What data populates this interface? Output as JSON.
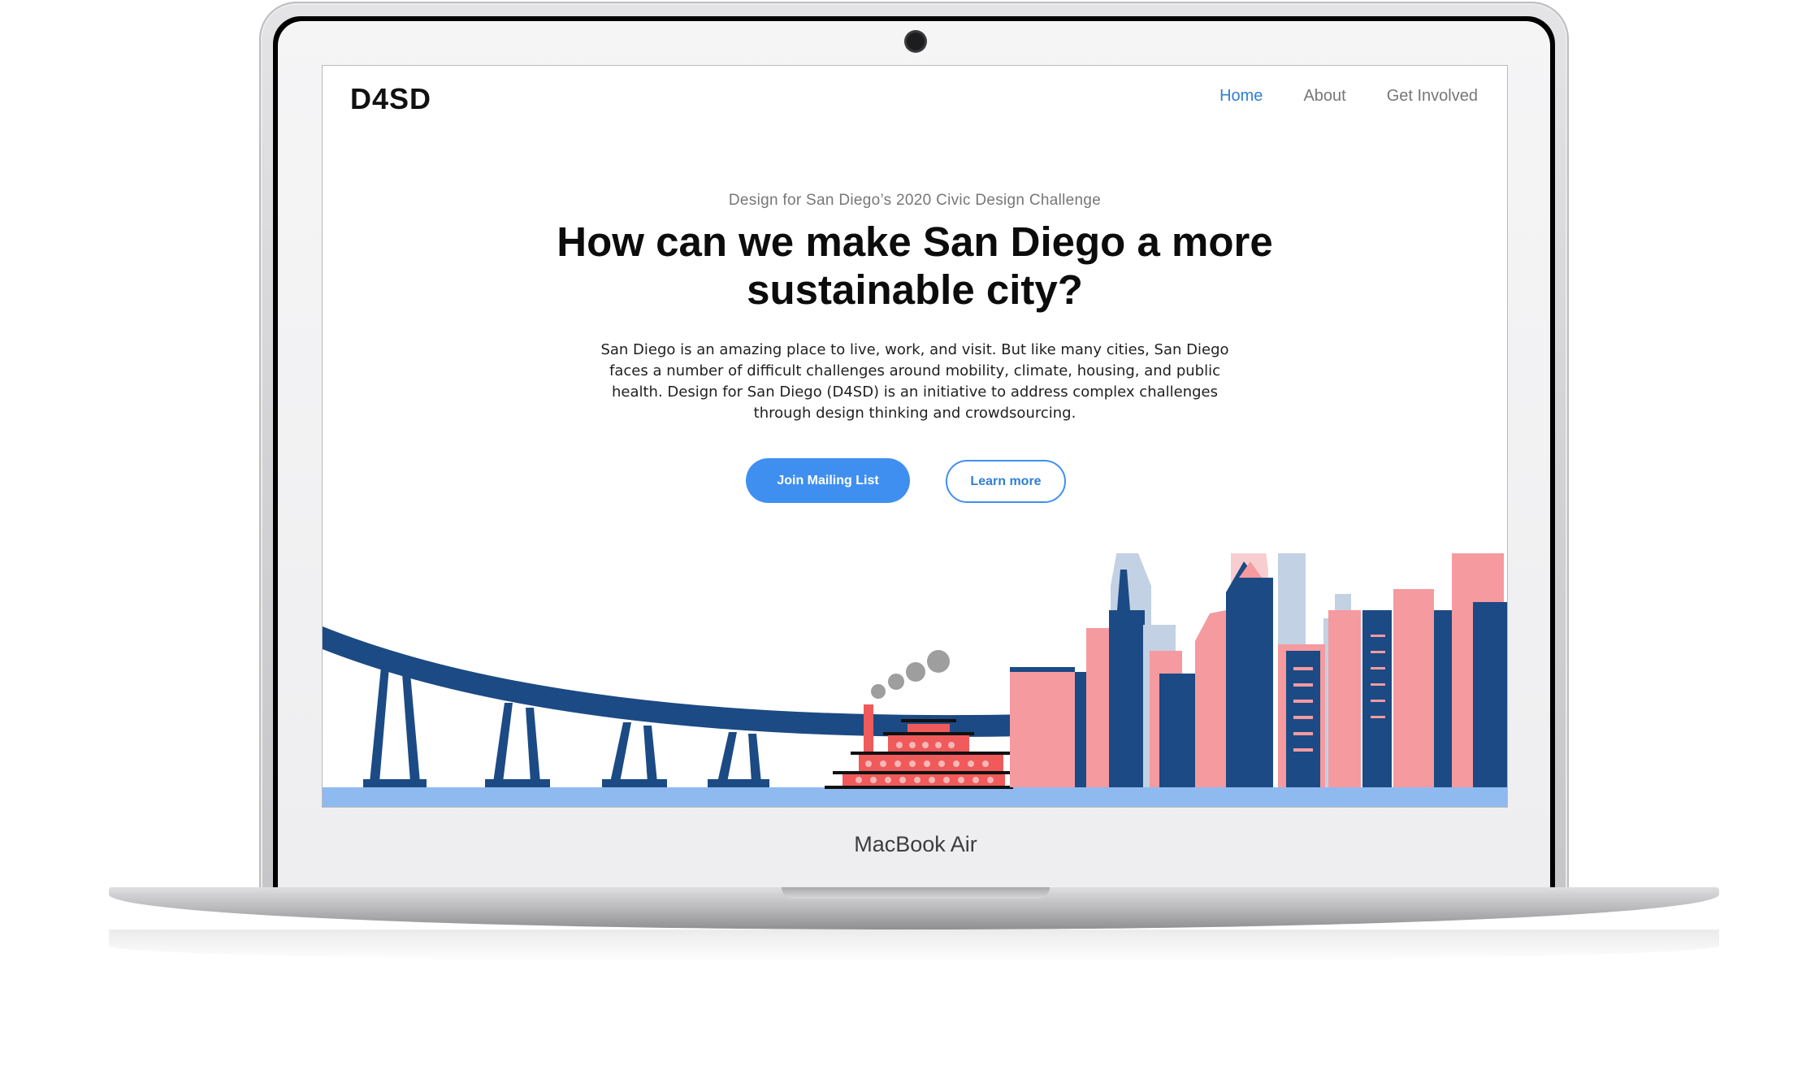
{
  "device": {
    "label": "MacBook Air"
  },
  "site": {
    "logo": "D4SD",
    "nav": {
      "home": "Home",
      "about": "About",
      "get_involved": "Get Involved"
    }
  },
  "hero": {
    "eyebrow": "Design for San Diego’s 2020 Civic Design Challenge",
    "headline": "How can we make San Diego a more sustainable city?",
    "body": "San Diego is an amazing place to live, work, and visit. But like many cities, San Diego faces a number of difficult challenges around mobility, climate, housing, and public health. Design for San Diego (D4SD) is an initiative to address complex challenges through design thinking and crowdsourcing.",
    "primary_button": "Join Mailing List",
    "secondary_button": "Learn more"
  },
  "colors": {
    "accent": "#3f8ff0",
    "navy": "#1c4a84",
    "pink": "#f59a9f",
    "red": "#f05a5a",
    "light_blue": "#9ec3ef"
  },
  "icons": {
    "webcam": "camera-icon"
  }
}
